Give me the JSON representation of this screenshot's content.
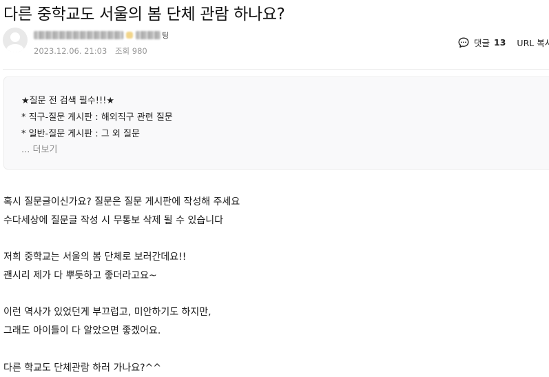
{
  "post": {
    "title": "다른 중학교도 서울의 봄 단체 관람 하나요?",
    "rank_suffix": "팅",
    "date": "2023.12.06. 21:03",
    "views": "조회 980"
  },
  "actions": {
    "comment_label": "댓글",
    "comment_count": "13",
    "url_copy_label": "URL 복사"
  },
  "notice": {
    "lines": [
      "★질문 전 검색 필수!!!★",
      "* 직구-질문 게시판 : 해외직구 관련 질문",
      "* 일반-질문 게시판 : 그 외 질문"
    ],
    "more_label": "... 더보기"
  },
  "content": {
    "lines": [
      "혹시 질문글이신가요? 질문은 질문 게시판에 작성해 주세요",
      "수다세상에 질문글 작성 시 무통보 삭제 될 수 있습니다",
      "저희 중학교는 서울의 봄 단체로 보러간데요!!",
      "괜시리 제가 다 뿌듯하고 좋더라고요~",
      "이런 역사가 있었던게 부끄럽고, 미안하기도 하지만,",
      "그래도 아이들이 다 알았으면 좋겠어요.",
      "다른 학교도 단체관람 하러 가나요?^^"
    ]
  }
}
